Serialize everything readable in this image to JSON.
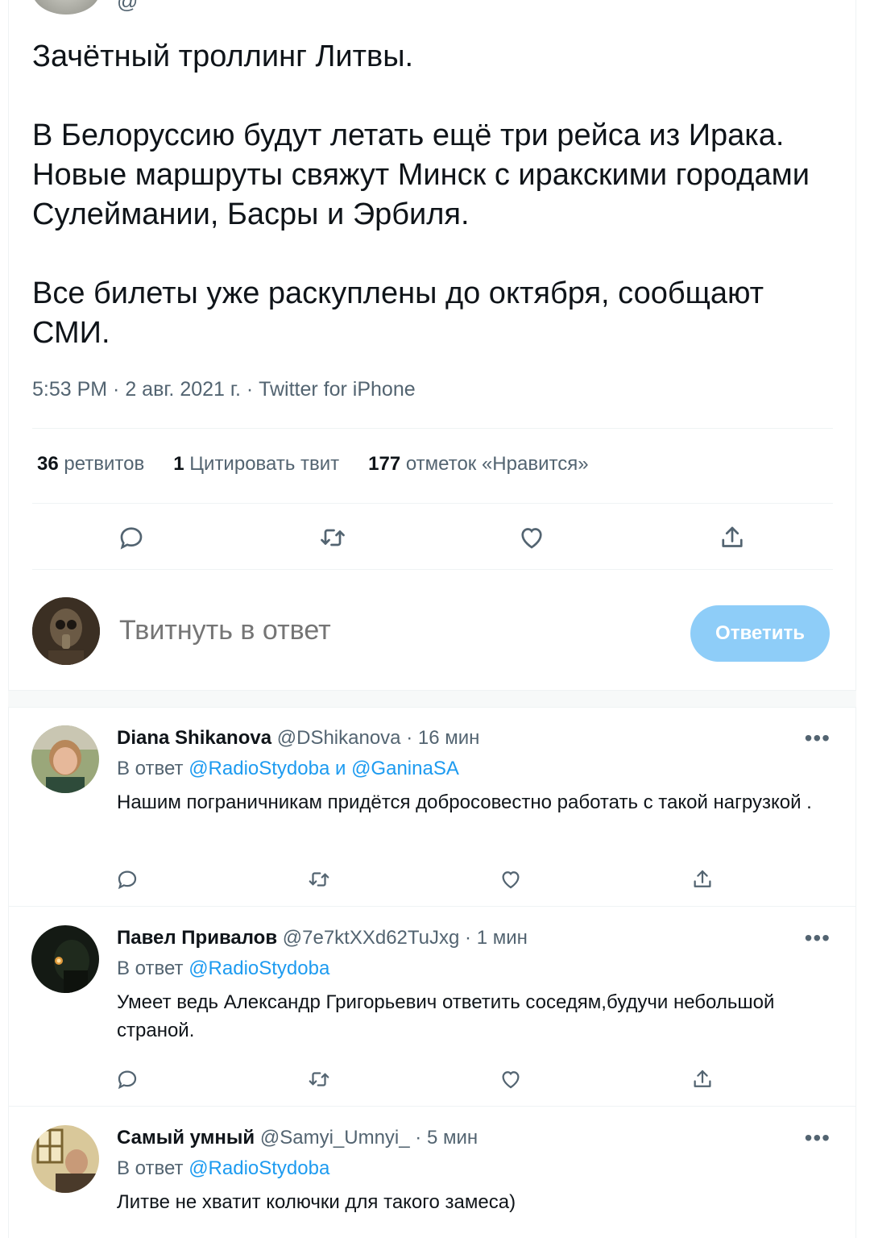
{
  "original_tweet": {
    "author_handle_partial": "@",
    "paragraphs": [
      "Зачётный троллинг Литвы.",
      "В Белоруссию будут летать ещё три рейса из Ирака. Новые маршруты свяжут Минск с иракскими городами Сулеймании, Басры и Эрбиля.",
      "Все билеты уже раскуплены до октября, сообщают СМИ."
    ],
    "meta": "5:53 PM · 2 авг. 2021 г. · Twitter for iPhone",
    "stats": {
      "retweets_count": "36",
      "retweets_label": "ретвитов",
      "quotes_count": "1",
      "quotes_label": "Цитировать твит",
      "likes_count": "177",
      "likes_label": "отметок «Нравится»"
    },
    "actions": [
      "reply-icon",
      "retweet-icon",
      "like-icon",
      "share-icon"
    ]
  },
  "compose": {
    "placeholder": "Твитнуть в ответ",
    "button_label": "Ответить",
    "button_color": "#8ecdf8"
  },
  "replies": [
    {
      "name": "Diana Shikanova",
      "handle": "@DShikanova",
      "time": "· 16 мин",
      "reply_prefix": "В ответ",
      "reply_targets": "@RadioStydoba и @GaninaSA",
      "text": "Нашим пограничникам придётся добросовестно работать с такой нагрузкой ."
    },
    {
      "name": "Павел Привалов",
      "handle": "@7e7ktXXd62TuJxg",
      "time": "· 1 мин",
      "reply_prefix": "В ответ",
      "reply_targets": "@RadioStydoba",
      "text": "Умеет ведь Александр Григорьевич ответить соседям,будучи небольшой страной."
    },
    {
      "name": "Самый умный",
      "handle": "@Samyi_Umnyi_",
      "time": "· 5 мин",
      "reply_prefix": "В ответ",
      "reply_targets": "@RadioStydoba",
      "text": "Литве не хватит колючки для такого замеса)"
    }
  ],
  "more_label": "•••",
  "colors": {
    "link": "#1d9bf0",
    "secondary_text": "#536471",
    "primary_text": "#0f1419"
  }
}
